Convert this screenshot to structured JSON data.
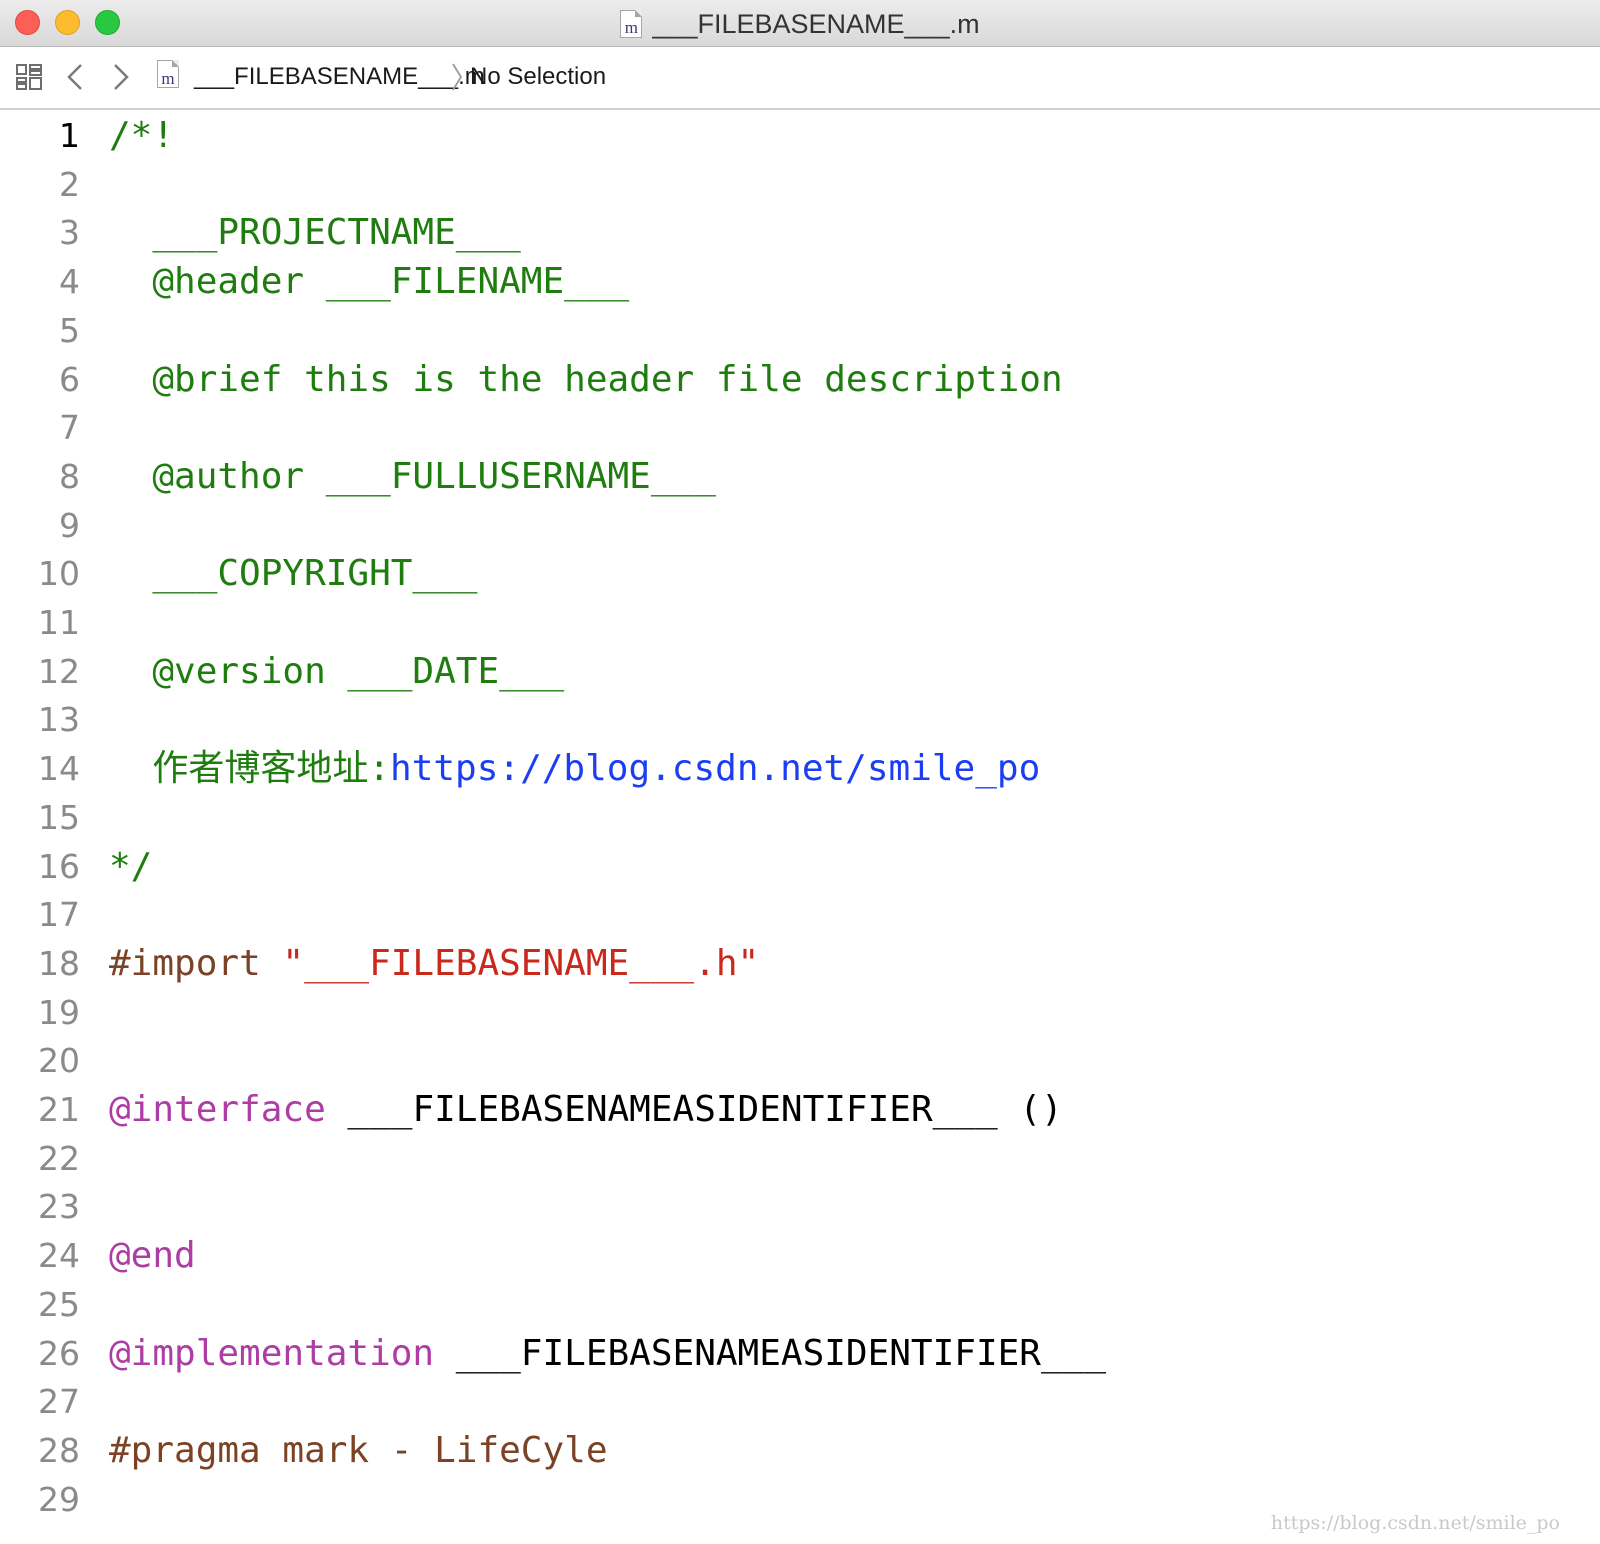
{
  "window": {
    "title": "___FILEBASENAME___.m",
    "file_icon_glyph": "m"
  },
  "jumpbar": {
    "file_name": "___FILEBASENAME___.m",
    "selection": "No Selection"
  },
  "editor": {
    "current_line": 1,
    "lines": [
      {
        "n": "1",
        "parts": [
          {
            "t": "/*!",
            "c": "comment"
          }
        ]
      },
      {
        "n": "2",
        "parts": []
      },
      {
        "n": "3",
        "parts": [
          {
            "t": "  ___PROJECTNAME___",
            "c": "comment"
          }
        ]
      },
      {
        "n": "4",
        "parts": [
          {
            "t": "  @header ___FILENAME___",
            "c": "comment"
          }
        ]
      },
      {
        "n": "5",
        "parts": []
      },
      {
        "n": "6",
        "parts": [
          {
            "t": "  @brief this is the header file description",
            "c": "comment"
          }
        ]
      },
      {
        "n": "7",
        "parts": []
      },
      {
        "n": "8",
        "parts": [
          {
            "t": "  @author ___FULLUSERNAME___",
            "c": "comment"
          }
        ]
      },
      {
        "n": "9",
        "parts": []
      },
      {
        "n": "10",
        "parts": [
          {
            "t": "  ___COPYRIGHT___",
            "c": "comment"
          }
        ]
      },
      {
        "n": "11",
        "parts": []
      },
      {
        "n": "12",
        "parts": [
          {
            "t": "  @version ___DATE___",
            "c": "comment"
          }
        ]
      },
      {
        "n": "13",
        "parts": []
      },
      {
        "n": "14",
        "parts": [
          {
            "t": "  作者博客地址:",
            "c": "comment"
          },
          {
            "t": "https://blog.csdn.net/smile_po",
            "c": "link"
          }
        ]
      },
      {
        "n": "15",
        "parts": []
      },
      {
        "n": "16",
        "parts": [
          {
            "t": "*/",
            "c": "comment"
          }
        ]
      },
      {
        "n": "17",
        "parts": []
      },
      {
        "n": "18",
        "parts": [
          {
            "t": "#import ",
            "c": "pre"
          },
          {
            "t": "\"___FILEBASENAME___.h\"",
            "c": "str"
          }
        ]
      },
      {
        "n": "19",
        "parts": []
      },
      {
        "n": "20",
        "parts": []
      },
      {
        "n": "21",
        "parts": [
          {
            "t": "@interface",
            "c": "kw"
          },
          {
            "t": " ___FILEBASENAMEASIDENTIFIER___ ()",
            "c": "plain"
          }
        ]
      },
      {
        "n": "22",
        "parts": []
      },
      {
        "n": "23",
        "parts": []
      },
      {
        "n": "24",
        "parts": [
          {
            "t": "@end",
            "c": "kw"
          }
        ]
      },
      {
        "n": "25",
        "parts": []
      },
      {
        "n": "26",
        "parts": [
          {
            "t": "@implementation",
            "c": "kw"
          },
          {
            "t": " ___FILEBASENAMEASIDENTIFIER___",
            "c": "plain"
          }
        ]
      },
      {
        "n": "27",
        "parts": []
      },
      {
        "n": "28",
        "parts": [
          {
            "t": "#pragma mark - LifeCyle",
            "c": "pre"
          }
        ]
      },
      {
        "n": "29",
        "parts": []
      }
    ]
  },
  "watermark": "https://blog.csdn.net/smile_po",
  "colors": {
    "comment": "#1f7d10",
    "link": "#1b3ef2",
    "preprocessor": "#7b4225",
    "string": "#c9281c",
    "keyword": "#ad3da4",
    "plain": "#000000"
  }
}
